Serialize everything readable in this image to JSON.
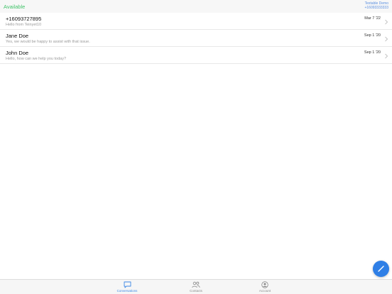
{
  "header": {
    "status": "Available",
    "account_name": "Textable Demo",
    "account_number": "+16093333333"
  },
  "conversations": [
    {
      "name": "+16093727895",
      "preview": "Hello from Teinyet10",
      "date": "Mar 7 '22"
    },
    {
      "name": "Jane Doe",
      "preview": "Yes, we would be happy to assist with that issue.",
      "date": "Sep 1 '20"
    },
    {
      "name": "John Doe",
      "preview": "Hello, how can we help you today?",
      "date": "Sep 1 '20"
    }
  ],
  "tabs": [
    {
      "label": "Conversations",
      "icon": "chat-bubble-icon",
      "active": true
    },
    {
      "label": "Contacts",
      "icon": "contacts-icon",
      "active": false
    },
    {
      "label": "Account",
      "icon": "account-icon",
      "active": false
    }
  ],
  "colors": {
    "status_green": "#43c46b",
    "accent_blue": "#2f7fe6",
    "tab_active": "#3d88e6"
  },
  "fab": {
    "icon": "compose-pencil-icon"
  }
}
